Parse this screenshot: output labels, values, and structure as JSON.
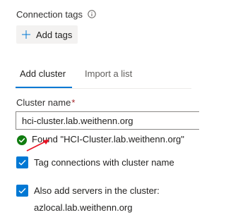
{
  "connection_tags": {
    "label": "Connection tags",
    "add_tags_label": "Add tags"
  },
  "tabs": [
    {
      "label": "Add cluster",
      "selected": true
    },
    {
      "label": "Import a list",
      "selected": false
    }
  ],
  "cluster_name": {
    "label": "Cluster name",
    "required_marker": "*",
    "value": "hci-cluster.lab.weithenn.org"
  },
  "validation": {
    "status": "success",
    "message": "Found \"HCI-Cluster.lab.weithenn.org\""
  },
  "options": {
    "tag_connections_label": "Tag connections with cluster name",
    "tag_connections_checked": true,
    "add_servers_label": "Also add servers in the cluster:",
    "add_servers_value": "azlocal.lab.weithenn.org",
    "add_servers_checked": true
  },
  "colors": {
    "accent": "#0078d4",
    "success": "#107c10",
    "annotation_arrow": "#e81123",
    "required": "#a4262c"
  }
}
